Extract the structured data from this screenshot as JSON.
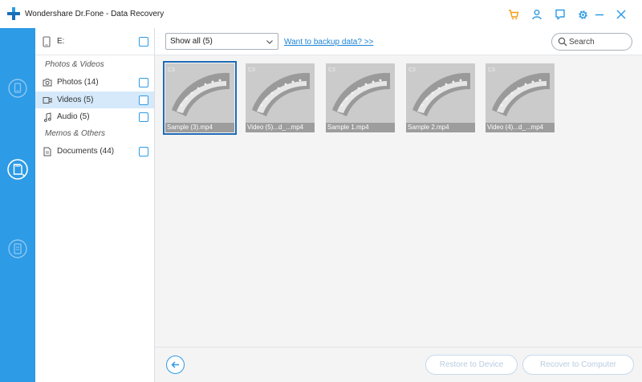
{
  "app": {
    "title": "Wondershare Dr.Fone - Data Recovery"
  },
  "titlebar": {
    "icons": [
      "cart-icon",
      "user-icon",
      "feedback-icon",
      "settings-icon",
      "minimize-icon",
      "close-icon"
    ]
  },
  "rail": {
    "items": [
      "phone-recover-icon",
      "sd-card-recover-icon",
      "backup-recover-icon"
    ]
  },
  "device": {
    "label": "E:"
  },
  "categories": {
    "section1": "Photos & Videos",
    "section2": "Memos & Others",
    "items": [
      {
        "label": "Photos (14)",
        "icon": "camera-icon"
      },
      {
        "label": "Videos (5)",
        "icon": "video-icon"
      },
      {
        "label": "Audio (5)",
        "icon": "music-icon"
      },
      {
        "label": "Documents (44)",
        "icon": "document-icon"
      }
    ]
  },
  "toolbar": {
    "filter_value": "Show all (5)",
    "backup_link": "Want to backup data? >>",
    "search_placeholder": "Search"
  },
  "files": [
    {
      "name": "Sample (3).mp4",
      "selected": true
    },
    {
      "name": "Video (5)...d_...mp4",
      "selected": false
    },
    {
      "name": "Sample 1.mp4",
      "selected": false
    },
    {
      "name": "Sample 2.mp4",
      "selected": false
    },
    {
      "name": "Video (4)...d_...mp4",
      "selected": false
    }
  ],
  "footer": {
    "restore_label": "Restore to Device",
    "recover_label": "Recover to Computer"
  },
  "colors": {
    "accent": "#2d9be6",
    "orange": "#f39c12",
    "selected_row": "#d5e9fa",
    "disabled_text": "#b9cde0"
  }
}
